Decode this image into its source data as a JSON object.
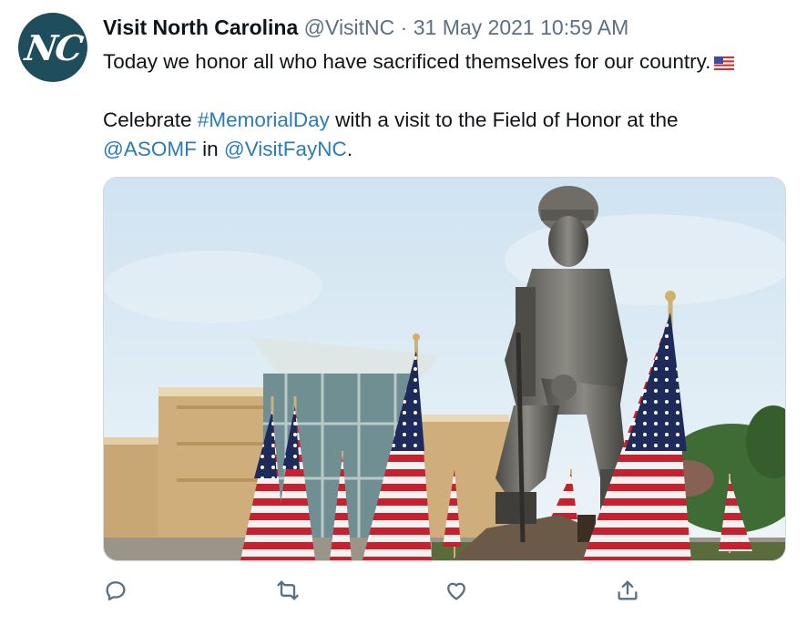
{
  "author": {
    "avatar_text": "NC",
    "display_name": "Visit North Carolina",
    "handle": "@VisitNC",
    "separator": "·",
    "timestamp": "31 May 2021 10:59 AM"
  },
  "tweet": {
    "line1": "Today we honor all who have sacrificed themselves for our country.",
    "line1_emoji": "us-flag-emoji",
    "line2_prefix": "Celebrate ",
    "hashtag": "#MemorialDay",
    "line2_middle": " with a visit to the Field of Honor at the",
    "mention1": "@ASOMF",
    "line3_middle": " in ",
    "mention2": "@VisitFayNC",
    "line3_suffix": "."
  },
  "media": {
    "description_icon": "photo-image"
  },
  "actions": [
    {
      "icon": "reply-icon"
    },
    {
      "icon": "retweet-icon"
    },
    {
      "icon": "like-icon"
    },
    {
      "icon": "share-icon"
    }
  ],
  "colors": {
    "link": "#2b7bb9",
    "secondary_text": "#5b7083",
    "avatar_bg": "#1e4e5c"
  }
}
